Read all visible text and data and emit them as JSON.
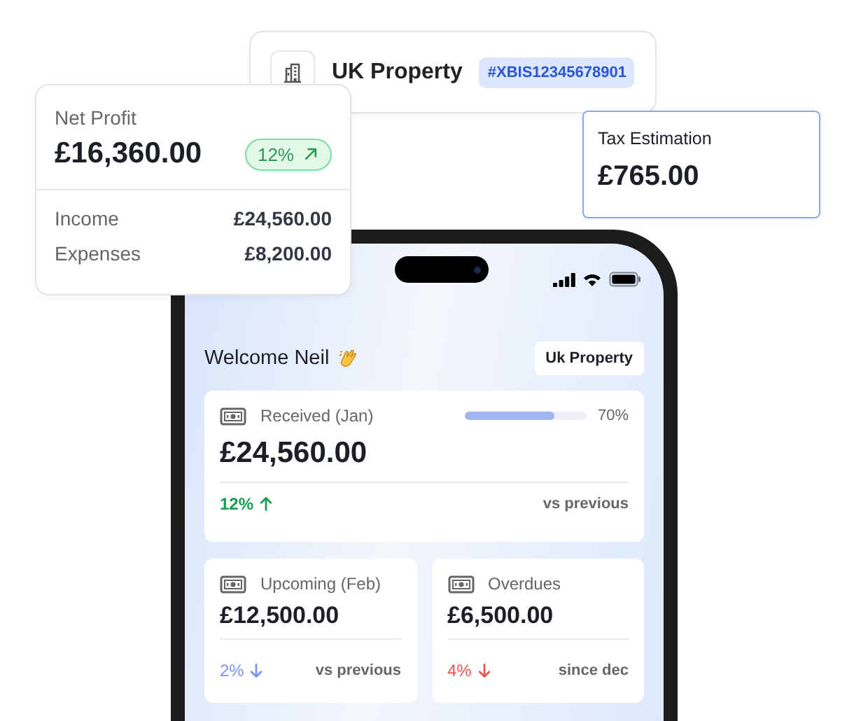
{
  "property": {
    "name": "UK Property",
    "tag": "#XBIS12345678901"
  },
  "net_profit": {
    "label": "Net Profit",
    "amount": "£16,360.00",
    "change": "12%",
    "kind": "up",
    "rows": [
      {
        "label": "Income",
        "value": "£24,560.00"
      },
      {
        "label": "Expenses",
        "value": "£8,200.00"
      }
    ]
  },
  "tax": {
    "label": "Tax Estimation",
    "amount": "£765.00"
  },
  "phone": {
    "greeting": "Welcome Neil",
    "property_button": "Uk Property",
    "cards": [
      {
        "label": "Received (Jan)",
        "amount": "£24,560.00",
        "level": 0.74,
        "reading": "70%",
        "change": "12%",
        "kind": "up",
        "color": "#169c52",
        "note": "vs previous"
      },
      {
        "label": "Upcoming (Feb)",
        "amount": "£12,500.00",
        "change": "2%",
        "kind": "down",
        "color": "#7b93f2",
        "note": "vs previous"
      },
      {
        "label": "Overdues",
        "amount": "£6,500.00",
        "change": "4%",
        "kind": "down",
        "color": "#ef5350",
        "note": "since dec"
      }
    ]
  }
}
